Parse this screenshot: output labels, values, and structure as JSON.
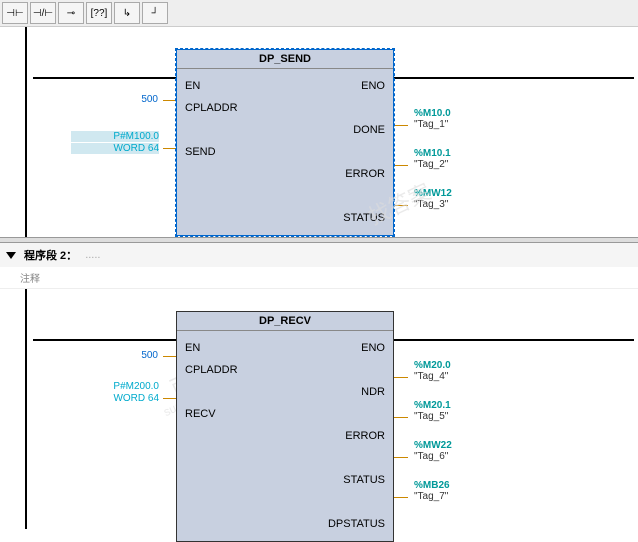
{
  "toolbar": {
    "btn1": "⊣⊢",
    "btn2": "⊣/⊢",
    "btn3": "⊸",
    "btn4": "[??]",
    "btn5": "↳",
    "btn6": "┘"
  },
  "block1": {
    "title": "DP_SEND",
    "ports": {
      "en": "EN",
      "eno": "ENO",
      "cpladdr": "CPLADDR",
      "send": "SEND",
      "done": "DONE",
      "error": "ERROR",
      "status": "STATUS"
    },
    "inputs": {
      "cpladdr_val": "500",
      "send_addr": "P#M100.0",
      "send_type": "WORD 64"
    },
    "outputs": {
      "done_addr": "%M10.0",
      "done_tag": "\"Tag_1\"",
      "error_addr": "%M10.1",
      "error_tag": "\"Tag_2\"",
      "status_addr": "%MW12",
      "status_tag": "\"Tag_3\""
    }
  },
  "network2": {
    "header": "程序段 2：",
    "header_dots": ".....",
    "comment": "注释"
  },
  "block2": {
    "title": "DP_RECV",
    "ports": {
      "en": "EN",
      "eno": "ENO",
      "cpladdr": "CPLADDR",
      "recv": "RECV",
      "ndr": "NDR",
      "error": "ERROR",
      "status": "STATUS",
      "dpstatus": "DPSTATUS"
    },
    "inputs": {
      "cpladdr_val": "500",
      "recv_addr": "P#M200.0",
      "recv_type": "WORD 64"
    },
    "outputs": {
      "ndr_addr": "%M20.0",
      "ndr_tag": "\"Tag_4\"",
      "error_addr": "%M20.1",
      "error_tag": "\"Tag_5\"",
      "status_addr": "%MW22",
      "status_tag": "\"Tag_6\"",
      "dpstatus_addr": "%MB26",
      "dpstatus_tag": "\"Tag_7\""
    }
  },
  "watermarks": {
    "w1": "找答案",
    "w2": "support.industry.siemens.com/cs",
    "w3": "西门子工业"
  }
}
